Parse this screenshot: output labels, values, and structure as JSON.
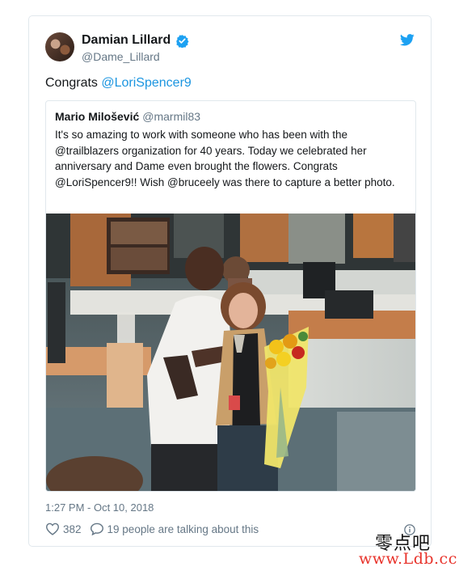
{
  "author": {
    "name": "Damian Lillard",
    "handle": "@Dame_Lillard",
    "verified": true
  },
  "tweet": {
    "text_prefix": "Congrats ",
    "mention": "@LoriSpencer9"
  },
  "quoted_tweet": {
    "name": "Mario Milošević",
    "handle": "@marmil83",
    "text": "It's so amazing to work with someone who has been with the @trailblazers organization for 40 years. Today we celebrated her anniversary and Dame even brought the flowers. Congrats @LoriSpencer9!! Wish @bruceely was there to capture a better photo."
  },
  "timestamp": "1:27 PM - Oct 10, 2018",
  "stats": {
    "likes": "382",
    "replies_text": "19 people are talking about this"
  },
  "icons": {
    "bird": "twitter-bird-icon",
    "verified": "verified-badge-icon",
    "heart": "heart-icon",
    "reply": "reply-bubble-icon",
    "info": "info-icon"
  },
  "colors": {
    "accent": "#1b95e0",
    "secondary_text": "#657786",
    "border": "#e1e8ed"
  },
  "watermark": {
    "chinese": "零点吧",
    "url": "www.Ldb.cc"
  }
}
